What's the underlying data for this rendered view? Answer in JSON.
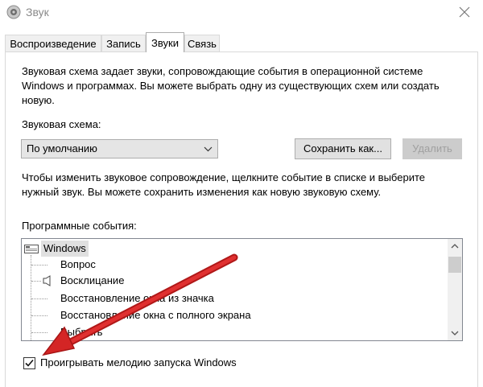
{
  "window": {
    "title": "Звук",
    "app_icon": "speaker-icon",
    "close_icon": "close-icon"
  },
  "tabs": [
    {
      "label": "Воспроизведение",
      "active": false
    },
    {
      "label": "Запись",
      "active": false
    },
    {
      "label": "Звуки",
      "active": true
    },
    {
      "label": "Связь",
      "active": false
    }
  ],
  "sounds": {
    "description_lines": [
      "Звуковая схема задает звуки, сопровождающие события в операционной системе",
      "Windows и программах. Вы можете выбрать одну из существующих схем или создать",
      "новую."
    ],
    "scheme_label": "Звуковая схема:",
    "scheme_value": "По умолчанию",
    "save_as_label": "Сохранить как...",
    "delete_label": "Удалить",
    "hint_lines": [
      "Чтобы изменить звуковое сопровождение, щелкните событие в списке и выберите",
      "нужный звук. Вы можете сохранить изменения как новую звуковую схему."
    ],
    "events_label": "Программные события:",
    "events": {
      "root": "Windows",
      "items": [
        {
          "label": "Вопрос",
          "has_sound_icon": false
        },
        {
          "label": "Восклицание",
          "has_sound_icon": true
        },
        {
          "label": "Восстановление окна из значка",
          "has_sound_icon": false
        },
        {
          "label": "Восстановление окна с полного экрана",
          "has_sound_icon": false
        },
        {
          "label": "Выбрать",
          "has_sound_icon": false
        }
      ]
    },
    "startup_sound_label": "Проигрывать мелодию запуска Windows",
    "startup_sound_checked": true
  },
  "colors": {
    "annotation_arrow": "#d42525",
    "selected_root_bg": "#e0e0e0"
  }
}
